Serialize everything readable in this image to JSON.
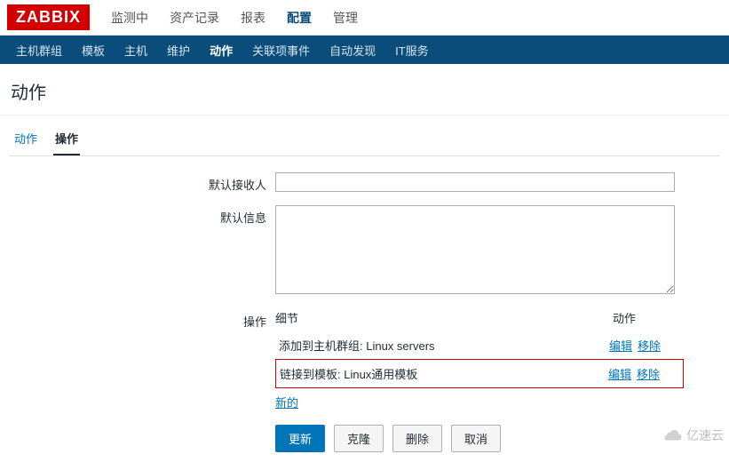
{
  "brand": "ZABBIX",
  "topnav": {
    "items": [
      "监测中",
      "资产记录",
      "报表",
      "配置",
      "管理"
    ],
    "active": 3
  },
  "subnav": {
    "items": [
      "主机群组",
      "模板",
      "主机",
      "维护",
      "动作",
      "关联项事件",
      "自动发现",
      "IT服务"
    ],
    "active": 4
  },
  "page": {
    "title": "动作"
  },
  "tabs": {
    "items": [
      "动作",
      "操作"
    ],
    "active": 1
  },
  "form": {
    "recipient": {
      "label": "默认接收人",
      "value": ""
    },
    "message": {
      "label": "默认信息",
      "value": ""
    },
    "operations": {
      "label": "操作",
      "header_detail": "细节",
      "header_action": "动作",
      "rows": [
        {
          "text": "添加到主机群组: Linux servers",
          "edit": "编辑",
          "remove": "移除",
          "highlight": false
        },
        {
          "text": "链接到模板: Linux通用模板",
          "edit": "编辑",
          "remove": "移除",
          "highlight": true
        }
      ],
      "new_label": "新的"
    }
  },
  "buttons": {
    "update": "更新",
    "clone": "克隆",
    "delete": "删除",
    "cancel": "取消"
  },
  "watermark": "亿速云"
}
